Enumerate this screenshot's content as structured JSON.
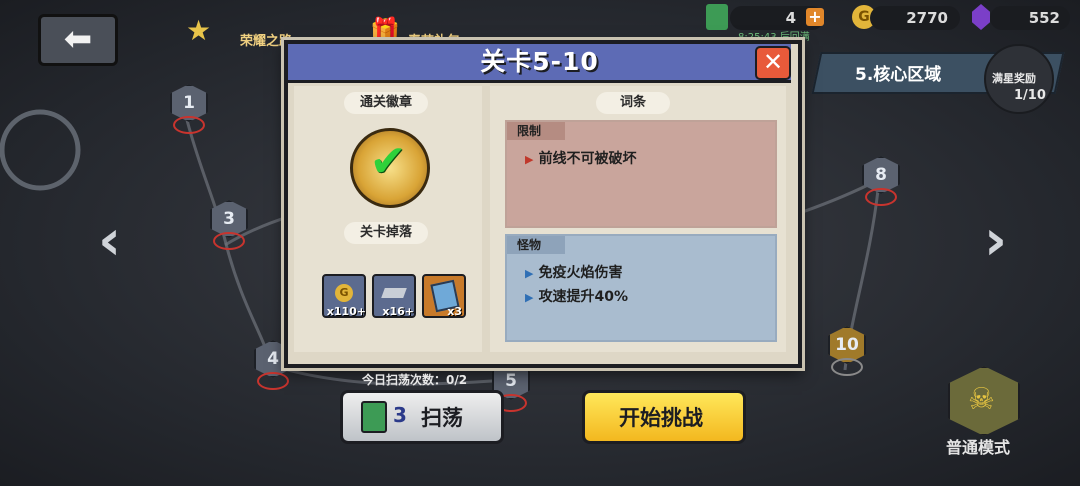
{
  "top_bar": {
    "back_icon": "back-arrow-icon",
    "tab1_label": "荣耀之路",
    "tab2_label": "春节礼包",
    "resources": [
      {
        "icon": "energy-can-icon",
        "value": "4"
      },
      {
        "icon": "gold-coin-icon",
        "value": "2770"
      },
      {
        "icon": "purple-gem-icon",
        "value": "552"
      }
    ],
    "timer": "8:25:43 后回满"
  },
  "zone": {
    "name": "5.核心区域",
    "reward_label": "满星奖励",
    "reward_progress": "1/10"
  },
  "map_nodes": [
    "1",
    "3",
    "4",
    "5",
    "8",
    "10"
  ],
  "dialog": {
    "title": "关卡5-10",
    "clear_badge_title": "通关徽章",
    "drops_title": "关卡掉落",
    "drops": [
      {
        "icon": "gold-coin-icon",
        "count": "x110+"
      },
      {
        "icon": "iron-ingot-icon",
        "count": "x16+"
      },
      {
        "icon": "equipment-chip-icon",
        "count": "x3"
      }
    ],
    "terms_title": "词条",
    "restriction": {
      "tag": "限制",
      "lines": [
        "前线不可被破坏"
      ]
    },
    "monster": {
      "tag": "怪物",
      "lines": [
        "免疫火焰伤害",
        "攻速提升40%"
      ]
    }
  },
  "sweep": {
    "count_label": "今日扫荡次数：0/2",
    "cost": "3",
    "label": "扫荡"
  },
  "start_label": "开始挑战",
  "mode_label": "普通模式",
  "colors": {
    "dialog_header": "#5d6bb5",
    "start_button": "#f3b81f",
    "restriction_box": "#c9a59c",
    "monster_box": "#a9bccf"
  }
}
